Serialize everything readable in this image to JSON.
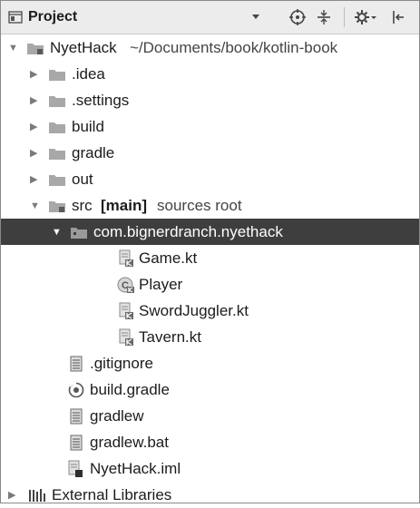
{
  "toolbar": {
    "title": "Project",
    "icons": [
      "project-view-icon",
      "dropdown-chevron-icon",
      "crosshair-icon",
      "collapse-all-icon",
      "settings-gear-icon",
      "hide-panel-icon"
    ]
  },
  "tree": {
    "root_name": "NyetHack",
    "root_path": "~/Documents/book/kotlin-book",
    "folders": [
      ".idea",
      ".settings",
      "build",
      "gradle",
      "out"
    ],
    "src_name": "src",
    "src_tag": "[main]",
    "src_note": "sources root",
    "package": "com.bignerdranch.nyethack",
    "package_files": [
      "Game.kt",
      "Player",
      "SwordJuggler.kt",
      "Tavern.kt"
    ],
    "root_files": [
      ".gitignore",
      "build.gradle",
      "gradlew",
      "gradlew.bat",
      "NyetHack.iml"
    ],
    "external_libraries": "External Libraries"
  },
  "colors": {
    "folder": "#a8a8a8",
    "selection": "#3e3e3e",
    "toolbar_bg": "#ececec"
  }
}
